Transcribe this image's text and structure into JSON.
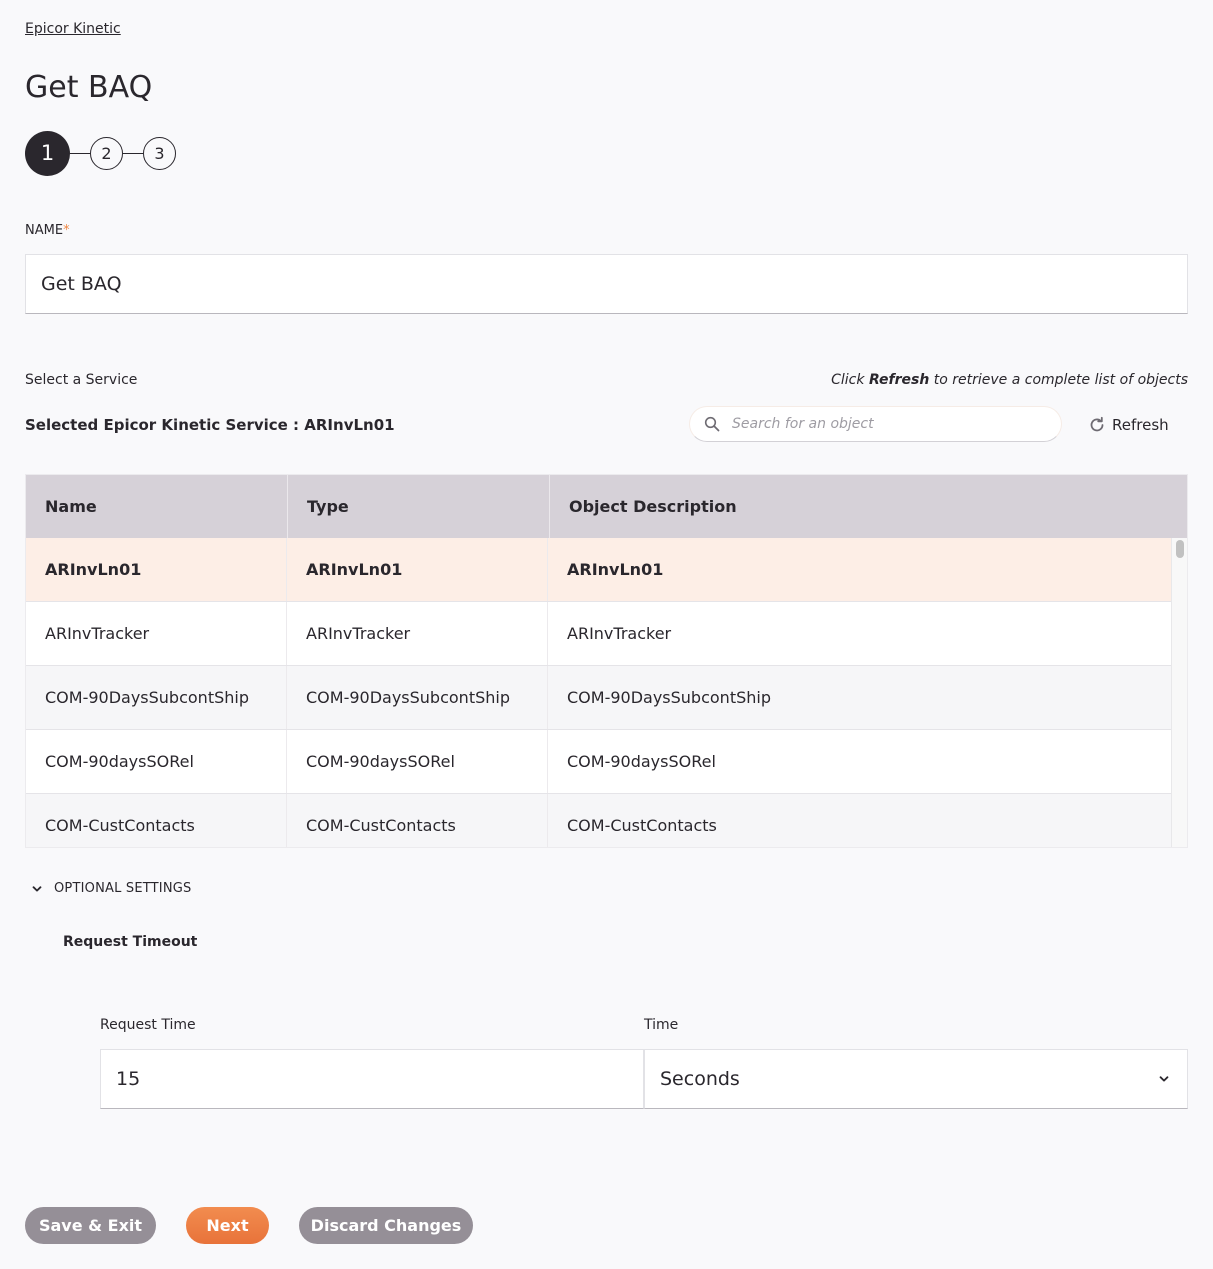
{
  "breadcrumb": "Epicor Kinetic",
  "page_title": "Get BAQ",
  "stepper": {
    "steps": [
      "1",
      "2",
      "3"
    ],
    "active_step": 1
  },
  "name_field": {
    "label": "NAME",
    "required_marker": "*",
    "value": "Get BAQ"
  },
  "service": {
    "label": "Select a Service",
    "hint_prefix": "Click ",
    "hint_bold": "Refresh",
    "hint_suffix": " to retrieve a complete list of objects",
    "selected_text": "Selected Epicor Kinetic Service : ARInvLn01",
    "search_placeholder": "Search for an object",
    "search_value": "",
    "refresh_label": "Refresh"
  },
  "table": {
    "columns": [
      "Name",
      "Type",
      "Object Description"
    ],
    "rows": [
      {
        "name": "ARInvLn01",
        "type": "ARInvLn01",
        "description": "ARInvLn01",
        "selected": true
      },
      {
        "name": "ARInvTracker",
        "type": "ARInvTracker",
        "description": "ARInvTracker",
        "selected": false
      },
      {
        "name": "COM-90DaysSubcontShip",
        "type": "COM-90DaysSubcontShip",
        "description": "COM-90DaysSubcontShip",
        "selected": false
      },
      {
        "name": "COM-90daysSORel",
        "type": "COM-90daysSORel",
        "description": "COM-90daysSORel",
        "selected": false
      },
      {
        "name": "COM-CustContacts",
        "type": "COM-CustContacts",
        "description": "COM-CustContacts",
        "selected": false
      }
    ]
  },
  "optional_settings": {
    "toggle_label": "OPTIONAL SETTINGS",
    "expanded": true,
    "section_title": "Request Timeout",
    "request_time_label": "Request Time",
    "request_time_value": "15",
    "time_label": "Time",
    "time_selected": "Seconds"
  },
  "buttons": {
    "save_exit": "Save & Exit",
    "next": "Next",
    "discard": "Discard Changes"
  },
  "colors": {
    "accent": "#f08743",
    "selected_row": "#fdeee6",
    "header_bg": "#d6d1d8",
    "secondary_button": "#958f97",
    "text": "#2a272d"
  }
}
